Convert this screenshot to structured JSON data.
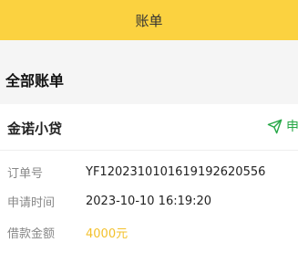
{
  "header": {
    "title": "账单"
  },
  "section": {
    "title": "全部账单"
  },
  "bill": {
    "product": "金诺小贷",
    "status": "申",
    "status_icon": "send-icon",
    "rows": [
      {
        "label": "订单号",
        "value": "YF1202310101619192620556"
      },
      {
        "label": "申请时间",
        "value": "2023-10-10 16:19:20"
      },
      {
        "label": "借款金额",
        "value": "4000元"
      }
    ]
  },
  "colors": {
    "header_bg": "#fbd240",
    "status_green": "#27a847",
    "amount_yellow": "#f3c12c"
  }
}
